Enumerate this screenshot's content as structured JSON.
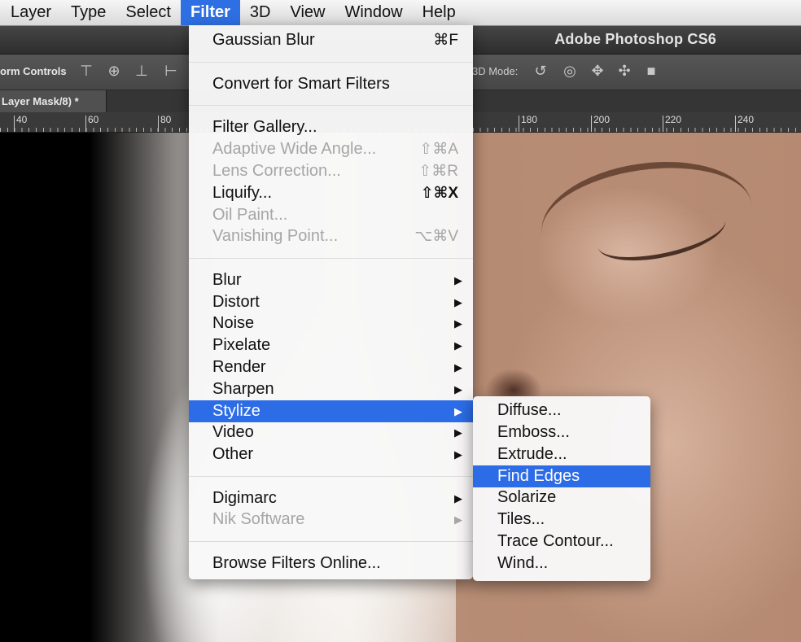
{
  "menubar": {
    "items": [
      {
        "label": "Layer"
      },
      {
        "label": "Type"
      },
      {
        "label": "Select"
      },
      {
        "label": "Filter"
      },
      {
        "label": "3D"
      },
      {
        "label": "View"
      },
      {
        "label": "Window"
      },
      {
        "label": "Help"
      }
    ],
    "active_item": "Filter"
  },
  "app": {
    "title": "Adobe Photoshop CS6"
  },
  "optionsbar": {
    "transform_controls_label": "orm Controls",
    "mode3d_label": "3D Mode:"
  },
  "document": {
    "tab_label": "Layer Mask/8) *"
  },
  "ruler": {
    "labels": [
      "40",
      "60",
      "80",
      "180",
      "200",
      "220",
      "240"
    ]
  },
  "filter_menu": {
    "items": [
      {
        "label": "Gaussian Blur",
        "shortcut": "⌘F",
        "enabled": true
      },
      {
        "label": "Convert for Smart Filters",
        "shortcut": "",
        "enabled": true
      },
      {
        "label": "Filter Gallery...",
        "shortcut": "",
        "enabled": true
      },
      {
        "label": "Adaptive Wide Angle...",
        "shortcut": "⇧⌘A",
        "enabled": false
      },
      {
        "label": "Lens Correction...",
        "shortcut": "⇧⌘R",
        "enabled": false
      },
      {
        "label": "Liquify...",
        "shortcut": "⇧⌘X",
        "enabled": true
      },
      {
        "label": "Oil Paint...",
        "shortcut": "",
        "enabled": false
      },
      {
        "label": "Vanishing Point...",
        "shortcut": "⌥⌘V",
        "enabled": false
      },
      {
        "label": "Blur",
        "submenu": true,
        "enabled": true
      },
      {
        "label": "Distort",
        "submenu": true,
        "enabled": true
      },
      {
        "label": "Noise",
        "submenu": true,
        "enabled": true
      },
      {
        "label": "Pixelate",
        "submenu": true,
        "enabled": true
      },
      {
        "label": "Render",
        "submenu": true,
        "enabled": true
      },
      {
        "label": "Sharpen",
        "submenu": true,
        "enabled": true
      },
      {
        "label": "Stylize",
        "submenu": true,
        "enabled": true,
        "selected": true
      },
      {
        "label": "Video",
        "submenu": true,
        "enabled": true
      },
      {
        "label": "Other",
        "submenu": true,
        "enabled": true
      },
      {
        "label": "Digimarc",
        "submenu": true,
        "enabled": true
      },
      {
        "label": "Nik Software",
        "submenu": true,
        "enabled": false
      },
      {
        "label": "Browse Filters Online...",
        "shortcut": "",
        "enabled": true
      }
    ],
    "submenu_arrow": "▶"
  },
  "stylize_submenu": {
    "items": [
      {
        "label": "Diffuse..."
      },
      {
        "label": "Emboss..."
      },
      {
        "label": "Extrude..."
      },
      {
        "label": "Find Edges",
        "selected": true
      },
      {
        "label": "Solarize"
      },
      {
        "label": "Tiles..."
      },
      {
        "label": "Trace Contour..."
      },
      {
        "label": "Wind..."
      }
    ]
  },
  "colors": {
    "selection_blue": "#2c6ce6",
    "menu_background": "#f8f8f8",
    "disabled_text": "#a6a6a6"
  }
}
